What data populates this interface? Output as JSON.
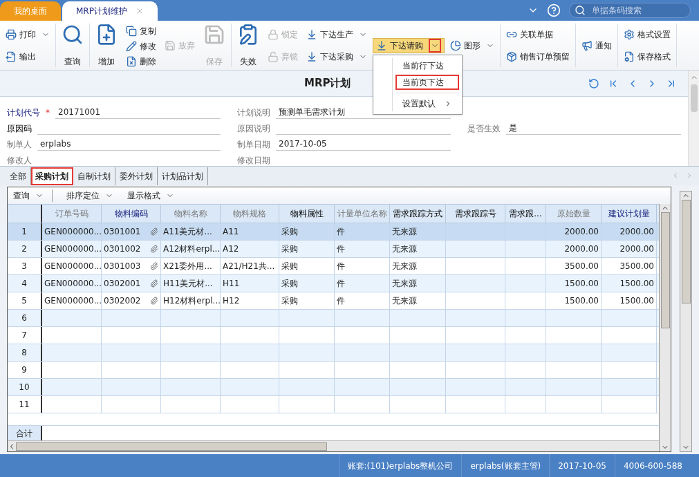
{
  "app_tabs": [
    {
      "label": "我的桌面",
      "selected": false,
      "closable": false
    },
    {
      "label": "MRP计划维护",
      "selected": true,
      "closable": true
    }
  ],
  "search": {
    "placeholder": "单据条码搜索"
  },
  "toolbar": [
    {
      "cols": [
        {
          "kind": "stack",
          "items": [
            {
              "label": "打印",
              "disabled": false,
              "dropdown": true
            },
            {
              "label": "输出",
              "disabled": false,
              "dropdown": false
            }
          ]
        }
      ]
    },
    {
      "cols": [
        {
          "kind": "large",
          "items": [
            {
              "label": "查询",
              "disabled": false,
              "dropdown": false
            }
          ]
        }
      ]
    },
    {
      "cols": [
        {
          "kind": "large",
          "items": [
            {
              "label": "增加",
              "disabled": false,
              "dropdown": false
            }
          ]
        },
        {
          "kind": "stack",
          "items": [
            {
              "label": "复制",
              "disabled": false,
              "dropdown": false
            },
            {
              "label": "修改",
              "disabled": false,
              "dropdown": false
            },
            {
              "label": "删除",
              "disabled": false,
              "dropdown": false
            }
          ]
        },
        {
          "kind": "stack",
          "items": [
            {
              "label": "放弃",
              "disabled": true,
              "dropdown": false
            }
          ]
        },
        {
          "kind": "large",
          "items": [
            {
              "label": "保存",
              "disabled": true,
              "dropdown": false
            }
          ]
        }
      ]
    },
    {
      "cols": [
        {
          "kind": "large",
          "items": [
            {
              "label": "失效",
              "disabled": false,
              "dropdown": false
            }
          ]
        },
        {
          "kind": "stack",
          "items": [
            {
              "label": "锁定",
              "disabled": true,
              "dropdown": false
            },
            {
              "label": "弃锁",
              "disabled": true,
              "dropdown": false
            }
          ]
        },
        {
          "kind": "stack",
          "items": [
            {
              "label": "下达生产",
              "disabled": false,
              "dropdown": true
            },
            {
              "label": "下达采购",
              "disabled": false,
              "dropdown": true
            }
          ]
        },
        {
          "kind": "split",
          "items": [
            {
              "label": "下达请购",
              "disabled": false,
              "dropdown": true,
              "open": true,
              "outlined": true
            }
          ]
        },
        {
          "kind": "stack",
          "items": [
            {
              "label": "图形",
              "disabled": false,
              "dropdown": true
            }
          ]
        }
      ]
    },
    {
      "cols": [
        {
          "kind": "stack",
          "items": [
            {
              "label": "关联单据",
              "disabled": false,
              "dropdown": false
            },
            {
              "label": "销售订单预留",
              "disabled": false,
              "dropdown": false
            }
          ]
        }
      ]
    },
    {
      "cols": [
        {
          "kind": "stack",
          "items": [
            {
              "label": "通知",
              "disabled": false,
              "dropdown": false
            }
          ]
        }
      ]
    },
    {
      "cols": [
        {
          "kind": "stack",
          "items": [
            {
              "label": "格式设置",
              "disabled": false,
              "dropdown": false
            },
            {
              "label": "保存格式",
              "disabled": false,
              "dropdown": false
            }
          ]
        }
      ]
    }
  ],
  "menu": [
    {
      "label": "当前行下达",
      "outlined": false,
      "submenu": false
    },
    {
      "label": "当前页下达",
      "outlined": true,
      "submenu": false
    },
    {
      "label": "设置默认",
      "outlined": false,
      "submenu": true
    }
  ],
  "title": "MRP计划",
  "form": [
    [
      {
        "label": "计划代号",
        "kind": "key",
        "mark": "*",
        "value": "20171001"
      },
      {
        "label": "计划说明",
        "kind": "muted",
        "value": "预测单毛需求计划"
      }
    ],
    [
      {
        "label": "原因码",
        "kind": "plain"
      },
      {
        "label": "原因说明",
        "kind": "muted"
      },
      {
        "label": "是否生效",
        "kind": "muted",
        "value": "是"
      }
    ],
    [
      {
        "label": "制单人",
        "kind": "muted",
        "value": "erplabs"
      },
      {
        "label": "制单日期",
        "kind": "muted",
        "value": "2017-10-05"
      }
    ],
    [
      {
        "label": "修改人",
        "kind": "muted"
      },
      {
        "label": "修改日期",
        "kind": "muted"
      }
    ]
  ],
  "sub_tabs": [
    {
      "label": "全部",
      "selected": false,
      "outlined": false
    },
    {
      "label": "采购计划",
      "selected": true,
      "outlined": true
    },
    {
      "label": "自制计划",
      "selected": false,
      "outlined": false
    },
    {
      "label": "委外计划",
      "selected": false,
      "outlined": false
    },
    {
      "label": "计划品计划",
      "selected": false,
      "outlined": false
    }
  ],
  "grid_toolbar": [
    "查询",
    "排序定位",
    "显示格式"
  ],
  "columns": [
    {
      "label": "订单号码",
      "kind": "muted"
    },
    {
      "label": "物料编码",
      "kind": "key"
    },
    {
      "label": "物料名称",
      "kind": "muted"
    },
    {
      "label": "物料规格",
      "kind": "muted"
    },
    {
      "label": "物料属性",
      "kind": "plain"
    },
    {
      "label": "计量单位名称",
      "kind": "muted"
    },
    {
      "label": "需求跟踪方式",
      "kind": "plain"
    },
    {
      "label": "需求跟踪号",
      "kind": "plain"
    },
    {
      "label": "需求跟...",
      "kind": "plain"
    },
    {
      "label": "原始数量",
      "kind": "muted"
    },
    {
      "label": "建议计划量",
      "kind": "key"
    }
  ],
  "rows": [
    {
      "number": "1",
      "selected": true,
      "attachment": true,
      "cells": [
        "GEN000000...",
        "0301001",
        "A11美元材...",
        "A11",
        "采购",
        "件",
        "无来源",
        "",
        "",
        "2000.00",
        "2000.00"
      ]
    },
    {
      "number": "2",
      "selected": false,
      "attachment": true,
      "cells": [
        "GEN000000...",
        "0301002",
        "A12材料erpl...",
        "A12",
        "采购",
        "件",
        "无来源",
        "",
        "",
        "2000.00",
        "2000.00"
      ]
    },
    {
      "number": "3",
      "selected": false,
      "attachment": true,
      "cells": [
        "GEN000000...",
        "0301003",
        "X21委外用...",
        "A21/H21共...",
        "采购",
        "件",
        "无来源",
        "",
        "",
        "3500.00",
        "3500.00"
      ]
    },
    {
      "number": "4",
      "selected": false,
      "attachment": true,
      "cells": [
        "GEN000000...",
        "0302001",
        "H11美元材...",
        "H11",
        "采购",
        "件",
        "无来源",
        "",
        "",
        "1500.00",
        "1500.00"
      ]
    },
    {
      "number": "5",
      "selected": false,
      "attachment": true,
      "cells": [
        "GEN000000...",
        "0302002",
        "H12材料erpl...",
        "H12",
        "采购",
        "件",
        "无来源",
        "",
        "",
        "1500.00",
        "1500.00"
      ]
    },
    {
      "number": "6",
      "selected": false,
      "attachment": false,
      "cells": []
    },
    {
      "number": "7",
      "selected": false,
      "attachment": false,
      "cells": []
    },
    {
      "number": "8",
      "selected": false,
      "attachment": false,
      "cells": []
    },
    {
      "number": "9",
      "selected": false,
      "attachment": false,
      "cells": []
    },
    {
      "number": "10",
      "selected": false,
      "attachment": false,
      "cells": []
    },
    {
      "number": "11",
      "selected": false,
      "attachment": false,
      "cells": []
    }
  ],
  "footer_label": "合计",
  "status_bar": [
    "账套:(101)erplabs整机公司",
    "erplabs(账套主管)",
    "2017-10-05",
    "4006-600-588"
  ]
}
